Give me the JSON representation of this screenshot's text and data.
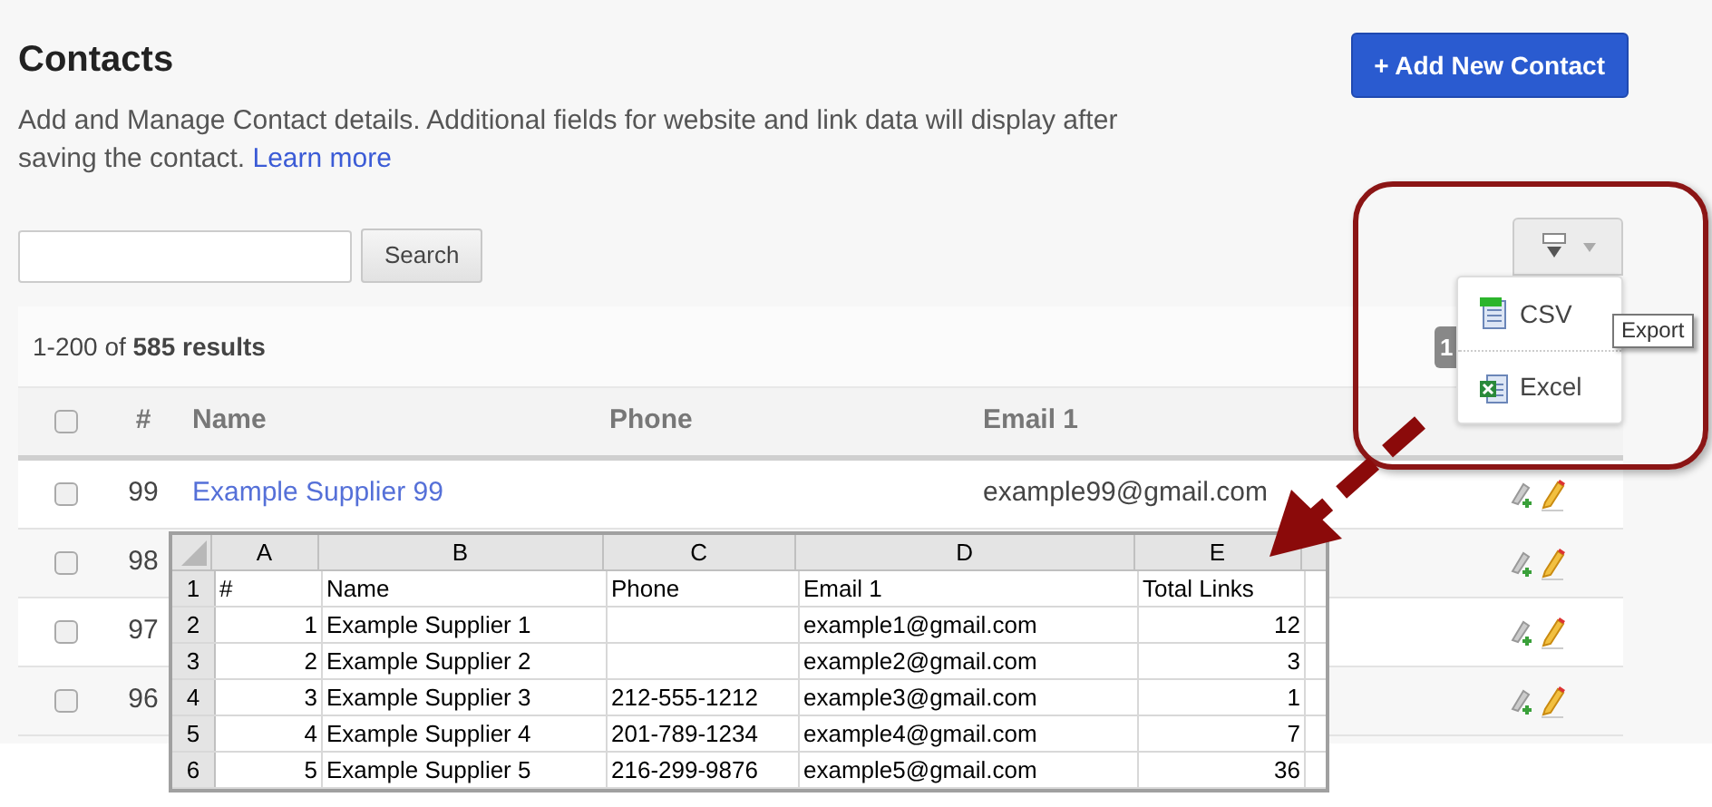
{
  "page": {
    "title": "Contacts",
    "description": "Add and Manage Contact details. Additional fields for website and link data will display after saving the contact.",
    "learn_more": "Learn more",
    "add_button": "+ Add New Contact"
  },
  "search": {
    "button": "Search"
  },
  "results": {
    "range": "1-200 of ",
    "count": "585 results",
    "page_badge": "1"
  },
  "table": {
    "select_all_checked": false,
    "columns": [
      "#",
      "Name",
      "Phone",
      "Email 1"
    ],
    "rows": [
      {
        "number": "99",
        "name": "Example Supplier 99",
        "email": "example99@gmail.com",
        "checked": false
      },
      {
        "number": "98",
        "checked": false
      },
      {
        "number": "97",
        "checked": false
      },
      {
        "number": "96",
        "checked": false
      }
    ]
  },
  "export_menu": {
    "items": [
      {
        "label": "CSV",
        "kind": "csv"
      },
      {
        "label": "Excel",
        "kind": "excel"
      }
    ],
    "tooltip": "Export"
  },
  "spreadsheet": {
    "columns": [
      "A",
      "B",
      "C",
      "D",
      "E"
    ],
    "rows": [
      {
        "index": "1",
        "kind": "header",
        "cells": [
          "#",
          "Name",
          "Phone",
          "Email 1",
          "Total Links"
        ]
      },
      {
        "index": "2",
        "kind": "data",
        "cells": [
          "1",
          "Example Supplier 1",
          "",
          "example1@gmail.com",
          "12"
        ]
      },
      {
        "index": "3",
        "kind": "data",
        "cells": [
          "2",
          "Example Supplier 2",
          "",
          "example2@gmail.com",
          "3"
        ]
      },
      {
        "index": "4",
        "kind": "data",
        "cells": [
          "3",
          "Example Supplier 3",
          "212-555-1212",
          "example3@gmail.com",
          "1"
        ]
      },
      {
        "index": "5",
        "kind": "data",
        "cells": [
          "4",
          "Example Supplier 4",
          "201-789-1234",
          "example4@gmail.com",
          "7"
        ]
      },
      {
        "index": "6",
        "kind": "data",
        "cells": [
          "5",
          "Example Supplier 5",
          "216-299-9876",
          "example5@gmail.com",
          "36"
        ]
      }
    ]
  }
}
